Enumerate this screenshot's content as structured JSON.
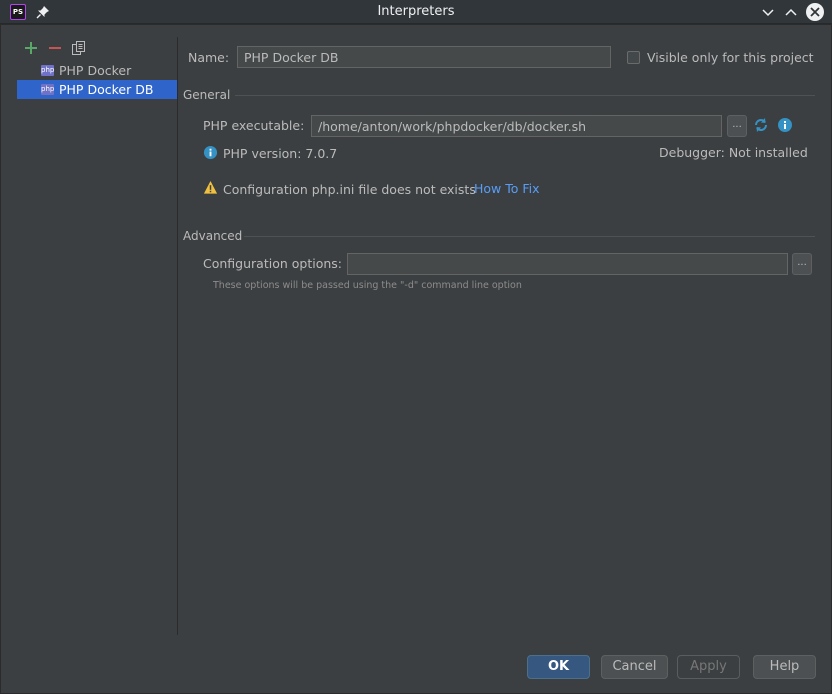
{
  "window": {
    "title": "Interpreters",
    "app_icon_text": "PS"
  },
  "colors": {
    "accent": "#2f65ca",
    "link": "#589df6",
    "warning": "#f0c040",
    "info": "#3592c4",
    "add": "#59a869",
    "remove": "#c75450"
  },
  "interpreters": {
    "items": [
      {
        "label": "PHP Docker",
        "icon": "php-icon",
        "selected": false
      },
      {
        "label": "PHP Docker DB",
        "icon": "php-icon",
        "selected": true
      }
    ]
  },
  "form": {
    "name_label": "Name:",
    "name_value": "PHP Docker DB",
    "visible_label": "Visible only for this project",
    "general_title": "General",
    "php_executable_label": "PHP executable:",
    "php_executable_value": "/home/anton/work/phpdocker/db/docker.sh",
    "browse_label": "...",
    "php_version_text": "PHP version: 7.0.7",
    "debugger_text": "Debugger: Not installed",
    "warning_text": "Configuration php.ini file does not exists",
    "how_to_fix": "How To Fix",
    "advanced_title": "Advanced",
    "config_options_label": "Configuration options:",
    "config_options_value": "",
    "config_hint": "These options will be passed using the \"-d\" command line option"
  },
  "footer": {
    "ok": "OK",
    "cancel": "Cancel",
    "apply": "Apply",
    "help": "Help"
  }
}
